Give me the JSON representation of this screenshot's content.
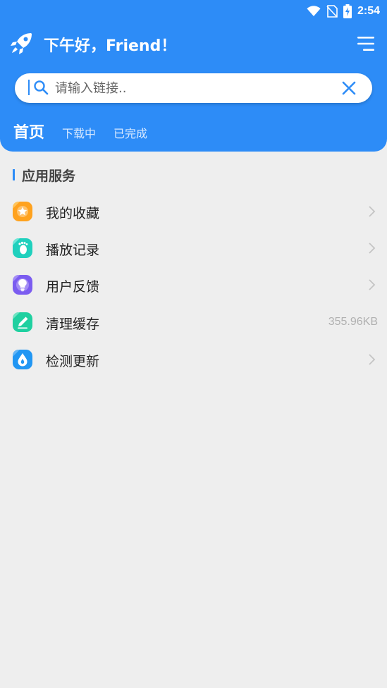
{
  "status_bar": {
    "time": "2:54",
    "icons": [
      "wifi-icon",
      "no-sim-icon",
      "battery-charging-icon"
    ]
  },
  "header": {
    "greeting": "下午好，Friend！",
    "logo_icon": "rocket-icon",
    "menu_icon": "menu-icon",
    "background_color": "#2d8cf7"
  },
  "search": {
    "placeholder": "请输入链接..",
    "value": "",
    "search_icon": "search-icon",
    "clear_icon": "close-icon"
  },
  "tabs": [
    {
      "label": "首页",
      "active": true
    },
    {
      "label": "下载中",
      "active": false
    },
    {
      "label": "已完成",
      "active": false
    }
  ],
  "section": {
    "title": "应用服务"
  },
  "items": [
    {
      "label": "我的收藏",
      "icon": "star-icon",
      "color": "#ffa21e",
      "trailing": "chevron"
    },
    {
      "label": "播放记录",
      "icon": "footprint-icon",
      "color": "#1fd0bd",
      "trailing": "chevron"
    },
    {
      "label": "用户反馈",
      "icon": "lightbulb-icon",
      "color": "#7b5cf0",
      "trailing": "chevron"
    },
    {
      "label": "清理缓存",
      "icon": "pencil-icon",
      "color": "#1fd0a0",
      "trailing": "value",
      "value": "355.96KB"
    },
    {
      "label": "检测更新",
      "icon": "water-drop-icon",
      "color": "#2196f3",
      "trailing": "chevron"
    }
  ]
}
